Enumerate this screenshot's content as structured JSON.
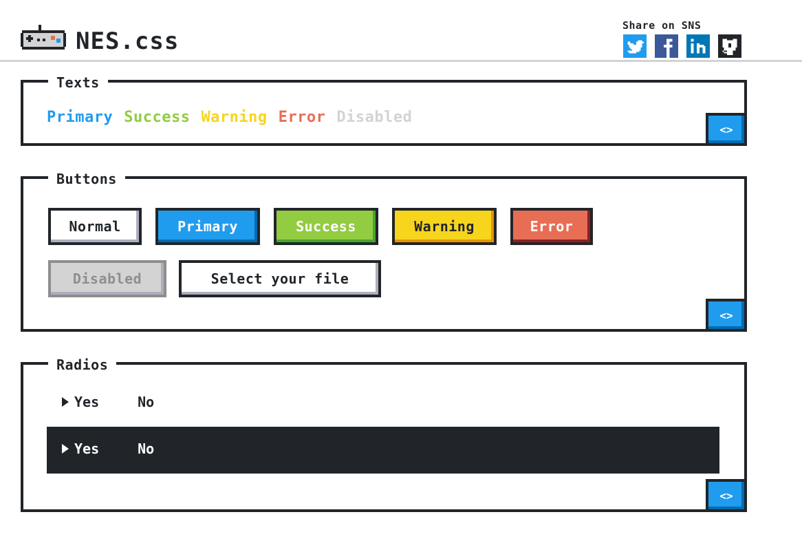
{
  "header": {
    "brand": "NES.css",
    "share_label": "Share on SNS",
    "sns": [
      "twitter-icon",
      "facebook-icon",
      "linkedin-icon",
      "github-icon"
    ]
  },
  "texts": {
    "title": "Texts",
    "items": {
      "primary": "Primary",
      "success": "Success",
      "warning": "Warning",
      "error": "Error",
      "disabled": "Disabled"
    },
    "code_label": "<>"
  },
  "buttons": {
    "title": "Buttons",
    "normal": "Normal",
    "primary": "Primary",
    "success": "Success",
    "warning": "Warning",
    "error": "Error",
    "disabled": "Disabled",
    "file": "Select your file",
    "code_label": "<>"
  },
  "radios": {
    "title": "Radios",
    "yes": "Yes",
    "no": "No",
    "dark_yes": "Yes",
    "dark_no": "No",
    "code_label": "<>"
  },
  "colors": {
    "primary": "#209cee",
    "success": "#92cc41",
    "warning": "#f7d51d",
    "error": "#e76e55",
    "disabled": "#d3d3d3",
    "dark": "#212529"
  }
}
